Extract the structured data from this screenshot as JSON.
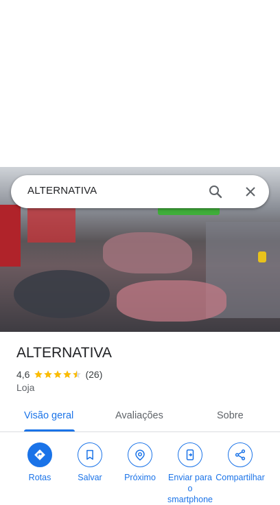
{
  "search": {
    "query": "ALTERNATIVA"
  },
  "place": {
    "name": "ALTERNATIVA",
    "rating": "4,6",
    "rating_value": 4.6,
    "review_count": "(26)",
    "category": "Loja"
  },
  "tabs": [
    {
      "label": "Visão geral",
      "active": true
    },
    {
      "label": "Avaliações",
      "active": false
    },
    {
      "label": "Sobre",
      "active": false
    }
  ],
  "actions": [
    {
      "label": "Rotas",
      "icon": "directions-icon"
    },
    {
      "label": "Salvar",
      "icon": "bookmark-icon"
    },
    {
      "label": "Próximo",
      "icon": "nearby-icon"
    },
    {
      "label": "Enviar para o smartphone",
      "icon": "send-to-phone-icon"
    },
    {
      "label": "Compartilhar",
      "icon": "share-icon"
    }
  ],
  "colors": {
    "accent": "#1a73e8",
    "star": "#fbbc04",
    "text": "#202124",
    "secondary": "#5f6368"
  }
}
